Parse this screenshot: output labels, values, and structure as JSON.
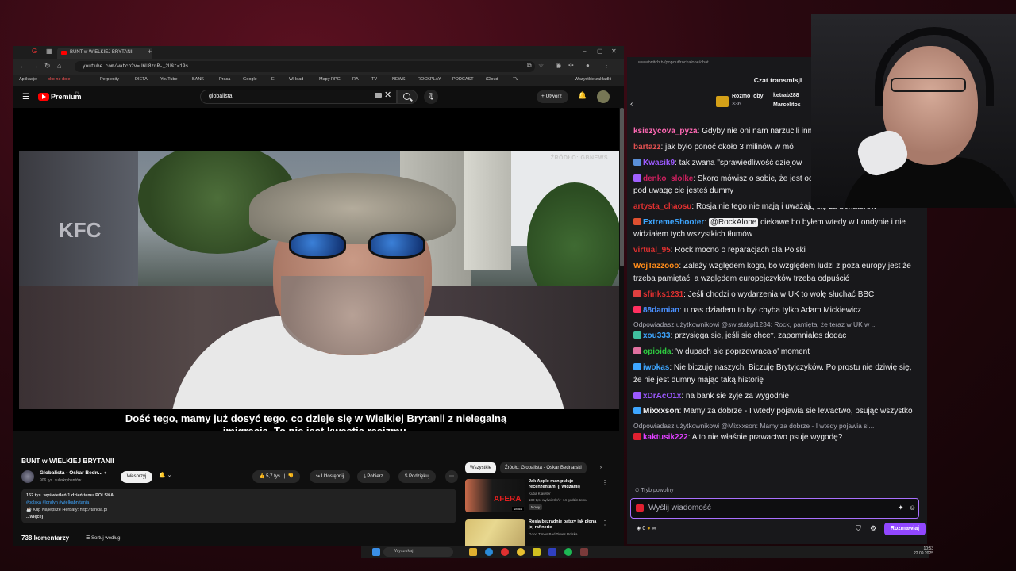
{
  "browser": {
    "tab_title": "BUNT w WIELKIEJ BRYTANII",
    "url": "youtube.com/watch?v=U6U8znR-_2U&t=19s",
    "bookmarks": [
      "Aplikacje",
      "oko ne dole",
      "Perplexity",
      "DIETA",
      "YouTube",
      "BANK",
      "Praca",
      "Google",
      "El",
      "WHead",
      "Mapy RPG",
      "RA",
      "TV",
      "NEWS",
      "ROCKPLAY",
      "PODCAST",
      "iCloud",
      "TV"
    ],
    "all_bookmarks": "Wszystkie zakładki"
  },
  "youtube": {
    "logo": "Premium",
    "logo_region": "PL",
    "search_value": "globalista",
    "create_label": "Utwórz",
    "video_watermark": "ŹRÓDŁO: GBNEWS",
    "subtitle_line1": "Dość tego, mamy już dosyć tego, co dzieje się w Wielkiej Brytanii z nielegalną",
    "subtitle_line2": "imigracją. To nie jest kwestia rasizmu.",
    "video_title": "BUNT w WIELKIEJ BRYTANII",
    "channel_name": "Globalista - Oskar Bedn...",
    "channel_subs": "906 tys. subskrybentów",
    "support_btn": "Wesprzyj",
    "likes": "5,7 tys.",
    "share": "Udostępnij",
    "download": "Pobierz",
    "thanks": "Podziękuj",
    "desc_stats": "152 tys. wyświetleń  1 dzień temu  POLSKA",
    "desc_tags": "#polska #londyn #wielkabrytania",
    "desc_line": "☕ Kup Najlepsze Herbaty: http://tancia.pl",
    "desc_more": "...więcej",
    "comments": "738 komentarzy",
    "sort": "Sortuj według",
    "chip_all": "Wszystkie",
    "chip_source": "Źródło: Globalista - Oskar Bednarski",
    "recs": [
      {
        "title": "Jak Apple manipuluje recenzentami (i widzami)",
        "channel": "Kuba Klawiter",
        "meta": "180 tys. wyświetleń • 14 godzin temu",
        "badge": "Nowy",
        "duration": "18:54",
        "thumb_text": "AFERA"
      },
      {
        "title": "Rosja bezradnie patrzy jak płoną jej rafinerie",
        "channel": "Good Times Bad Times Polska",
        "meta": "",
        "badge": "",
        "duration": "",
        "thumb_text": ""
      }
    ]
  },
  "taskbar": {
    "search": "Wyszukaj",
    "time": "10:53",
    "date": "22.09.2025"
  },
  "twitch": {
    "url": "www.twitch.tv/popout/rockalone/chat",
    "title": "Czat transmisji",
    "gifter_name": "RozmoToby",
    "gifter_count": "336",
    "gifter2": "ketrab288",
    "gifter3": "Marcelitos",
    "messages": [
      {
        "user": "ksiezycova_pyza",
        "color": "#ff69b4",
        "text": "Gdyby nie oni nam narzucili inny by to zrobił",
        "badge": ""
      },
      {
        "user": "bartazz",
        "color": "#e05050",
        "text": "jak było ponoć około 3 milinów w mó",
        "badge": ""
      },
      {
        "user": "Kwasik9",
        "color": "#9b59ff",
        "text": "tak zwana \"sprawiedliwość dziejow",
        "badge": "#5b8fd8"
      },
      {
        "user": "denko_slolke",
        "color": "#d02060",
        "text": "Skoro mówisz o sobie, że jest oddany swojemu państwu bierz pod uwagę cie jesteś dumny",
        "badge": "#a060ff"
      },
      {
        "user": "artysta_chaosu",
        "color": "#e03030",
        "text": "Rosja nie tego nie mają i uważają się za bohaterów",
        "badge": ""
      },
      {
        "user": "ExtremeShooter",
        "color": "#3ea6ff",
        "text": "ciekawe bo byłem wtedy w Londynie i nie widziałem tych wszystkich tłumów",
        "mention": "@RockAlone",
        "badge": "#e05030"
      },
      {
        "user": "virtual_95",
        "color": "#e03030",
        "text": "Rock mocno o reparacjach dla Polski",
        "badge": ""
      },
      {
        "user": "WojTazzooo",
        "color": "#ff8c1a",
        "text": "Zależy względem kogo, bo względem ludzi z poza europy jest że trzeba pamiętać, a względem europejczyków trzeba odpuścić",
        "badge": ""
      },
      {
        "user": "sfinks1231",
        "color": "#e03030",
        "text": "Jeśli chodzi o wydarzenia w UK to wolę słuchać BBC",
        "badge": "#e04040"
      },
      {
        "user": "88damian",
        "color": "#4a90ff",
        "text": "u nas dziadem to był chyba tylko Adam Mickiewicz",
        "badge": "#ff3060"
      },
      {
        "reply": "Odpowiadasz użytkownikowi @swistakpl1234: Rock, pamiętaj że teraz w UK w ..."
      },
      {
        "user": "xou333",
        "color": "#3ea6ff",
        "text": "przysięga sie, jeśli sie chce*. zapomniales dodac",
        "badge": "#40c0a0"
      },
      {
        "user": "opioida",
        "color": "#2ecc40",
        "text": "'w dupach sie poprzewracało' moment",
        "badge": "#e070a0"
      },
      {
        "user": "iwokas",
        "color": "#3ea6ff",
        "text": "Nie biczuję naszych. Biczuję Brytyjczyków. Po prostu nie dziwię się, że nie jest dumny mając taką historię",
        "badge": "#3ea6ff"
      },
      {
        "user": "xDrAcO1x",
        "color": "#9b59ff",
        "text": "na bank sie zyje za wygodnie",
        "badge": "#9b59ff"
      },
      {
        "user": "Mixxxson",
        "color": "#efeff1",
        "text": "Mamy za dobrze - I wtedy pojawia sie lewactwo, psując wszystko",
        "badge": "#3ea6ff"
      },
      {
        "reply": "Odpowiadasz użytkownikowi @Mixxxson: Mamy za dobrze - I wtedy pojawia si..."
      },
      {
        "user": "kaktusik222",
        "color": "#e040ff",
        "text": "A to nie właśnie prawactwo psuje wygodę?",
        "badge": "#e02030"
      }
    ],
    "slow_mode": "Tryb powolny",
    "placeholder": "Wyślij wiadomość",
    "points": "0",
    "chat_button": "Rozmawiaj"
  }
}
